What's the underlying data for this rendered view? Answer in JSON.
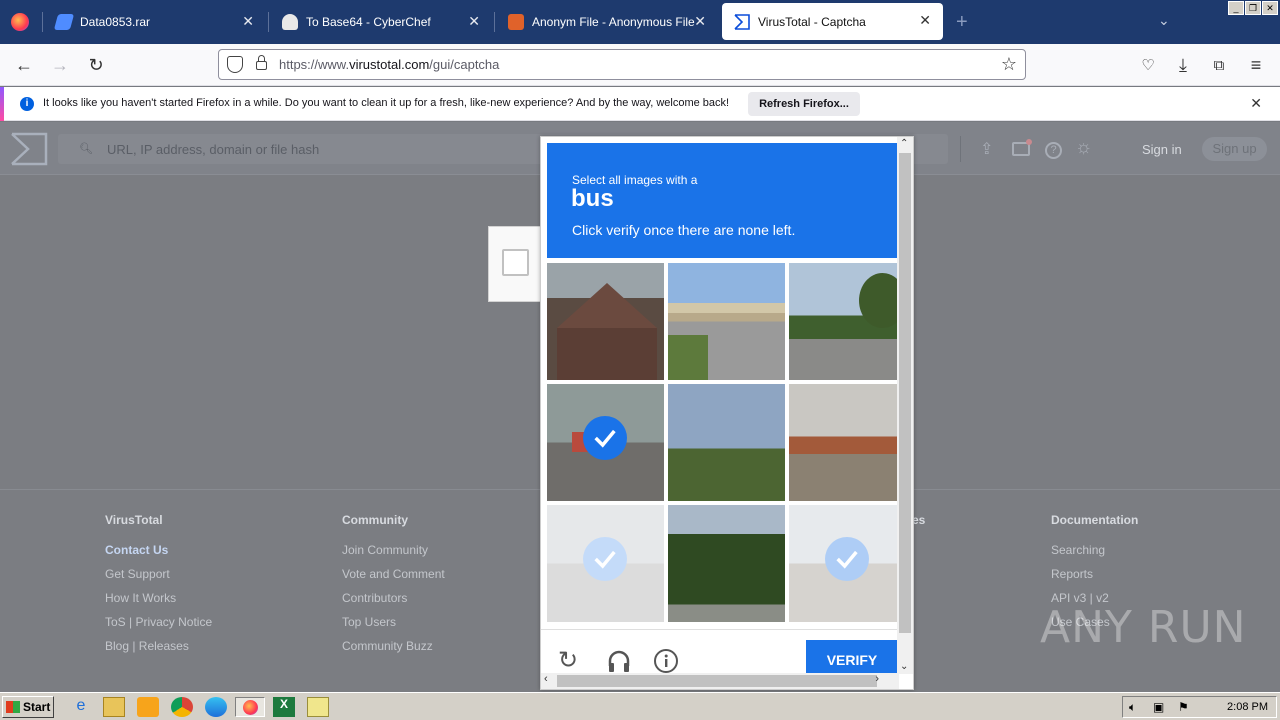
{
  "browser": {
    "tabs": [
      {
        "title": "Data0853.rar",
        "active": false
      },
      {
        "title": "To Base64 - CyberChef",
        "active": false
      },
      {
        "title": "Anonym File - Anonymous File Uplo",
        "active": false
      },
      {
        "title": "VirusTotal - Captcha",
        "active": true
      }
    ],
    "url_prefix": "https://www.",
    "url_domain": "virustotal.com",
    "url_path": "/gui/captcha"
  },
  "notification": {
    "message": "It looks like you haven't started Firefox in a while. Do you want to clean it up for a fresh, like-new experience? And by the way, welcome back!",
    "button": "Refresh Firefox..."
  },
  "vt": {
    "search_placeholder": "URL, IP address, domain or file hash",
    "sign_in": "Sign in",
    "sign_up": "Sign up"
  },
  "footer": {
    "columns": [
      {
        "heading": "VirusTotal",
        "links": [
          "Contact Us",
          "Get Support",
          "How It Works",
          "ToS | Privacy Notice",
          "Blog | Releases"
        ]
      },
      {
        "heading": "Community",
        "links": [
          "Join Community",
          "Vote and Comment",
          "Contributors",
          "Top Users",
          "Community Buzz"
        ]
      },
      {
        "heading": "es",
        "links": []
      },
      {
        "heading": "Documentation",
        "links": [
          "Searching",
          "Reports",
          "API v3 | v2",
          "Use Cases"
        ]
      }
    ]
  },
  "captcha": {
    "line1": "Select all images with a",
    "target": "bus",
    "line3": "Click verify once there are none left.",
    "verify": "VERIFY",
    "tiles": [
      {
        "scene": "brick building",
        "selected": false,
        "faded": false
      },
      {
        "scene": "highway overpass",
        "selected": false,
        "faded": false
      },
      {
        "scene": "street with trees",
        "selected": false,
        "faded": false
      },
      {
        "scene": "bus on road",
        "selected": true,
        "faded": false
      },
      {
        "scene": "trees and sky",
        "selected": false,
        "faded": false
      },
      {
        "scene": "storefront",
        "selected": false,
        "faded": false
      },
      {
        "scene": "bus on road",
        "selected": true,
        "faded": true
      },
      {
        "scene": "trees",
        "selected": false,
        "faded": false
      },
      {
        "scene": "bus",
        "selected": true,
        "faded": true
      }
    ]
  },
  "watermark": "ANY RUN",
  "taskbar": {
    "start": "Start",
    "clock": "2:08 PM"
  }
}
